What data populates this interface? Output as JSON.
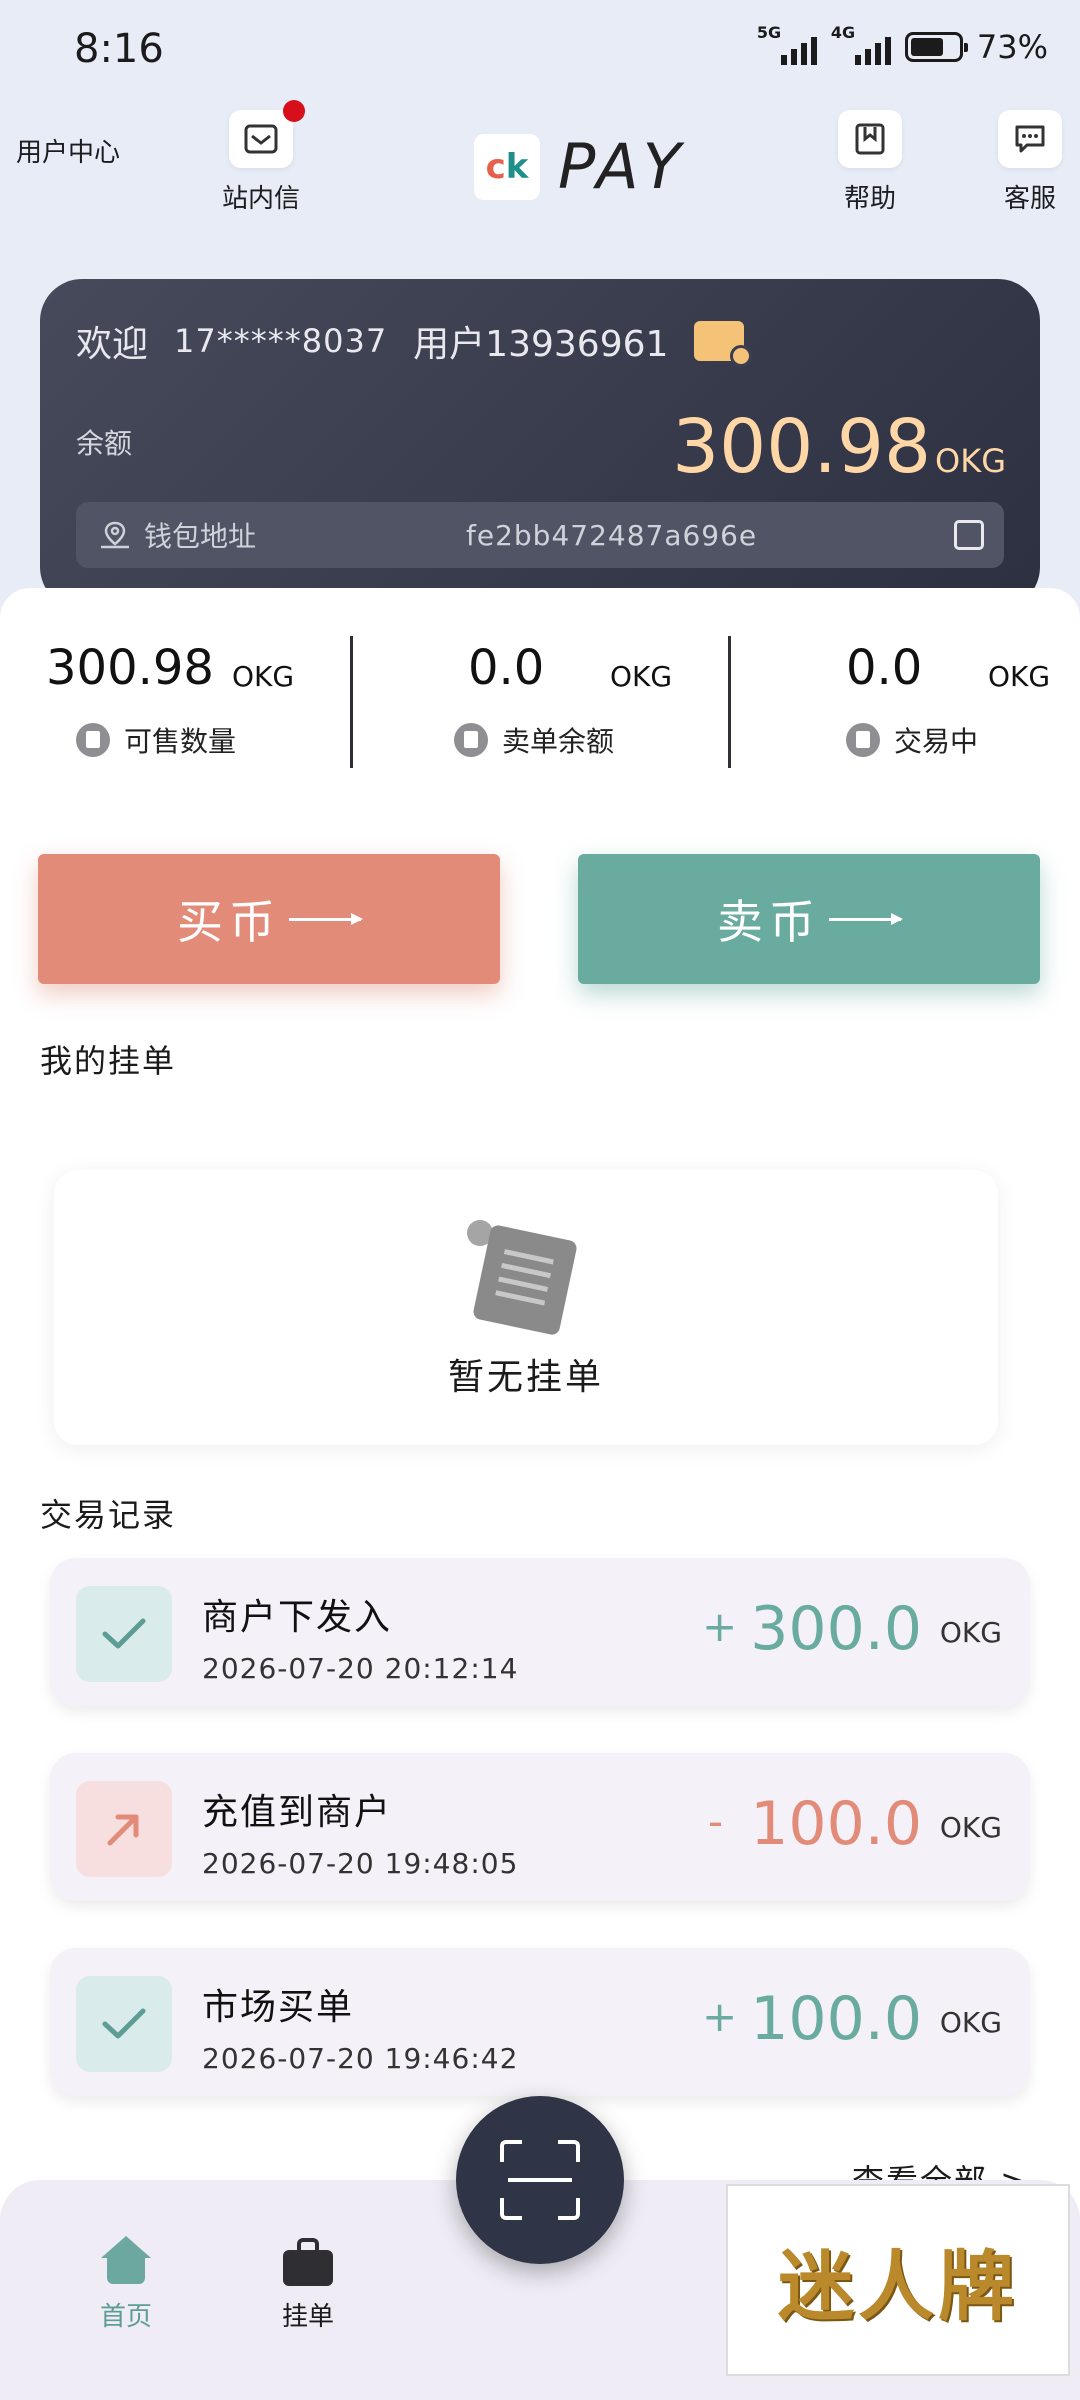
{
  "status": {
    "time": "8:16",
    "net1": "5G",
    "net2": "4G",
    "battery": "73%"
  },
  "topnav": {
    "user_center": "用户中心",
    "inbox": "站内信",
    "help": "帮助",
    "support": "客服",
    "logo_text": "PAY"
  },
  "account": {
    "welcome": "欢迎",
    "phone": "17*****8037",
    "username": "用户13936961",
    "balance_label": "余额",
    "balance": "300.98",
    "balance_unit": "OKG",
    "wallet_label": "钱包地址",
    "wallet_address": "fe2bb472487a696e"
  },
  "stats": [
    {
      "value": "300.98",
      "unit": "OKG",
      "label": "可售数量"
    },
    {
      "value": "0.0",
      "unit": "OKG",
      "label": "卖单余额"
    },
    {
      "value": "0.0",
      "unit": "OKG",
      "label": "交易中"
    }
  ],
  "actions": {
    "buy": "买币",
    "sell": "卖币"
  },
  "orders": {
    "title": "我的挂单",
    "empty": "暂无挂单"
  },
  "records": {
    "title": "交易记录",
    "items": [
      {
        "title": "商户下发入",
        "time": "2026-07-20 20:12:14",
        "sign": "+",
        "amount": "300.0",
        "unit": "OKG",
        "type": "in"
      },
      {
        "title": "充值到商户",
        "time": "2026-07-20 19:48:05",
        "sign": "-",
        "amount": "100.0",
        "unit": "OKG",
        "type": "out"
      },
      {
        "title": "市场买单",
        "time": "2026-07-20 19:46:42",
        "sign": "+",
        "amount": "100.0",
        "unit": "OKG",
        "type": "in"
      }
    ],
    "view_all": "查看全部 >"
  },
  "bottom_nav": {
    "home": "首页",
    "orders": "挂单"
  },
  "watermark": "迷人牌",
  "colors": {
    "buy": "#e18b78",
    "sell": "#69ab9e",
    "balance": "#ffd6a6",
    "card": "#2c3040"
  }
}
